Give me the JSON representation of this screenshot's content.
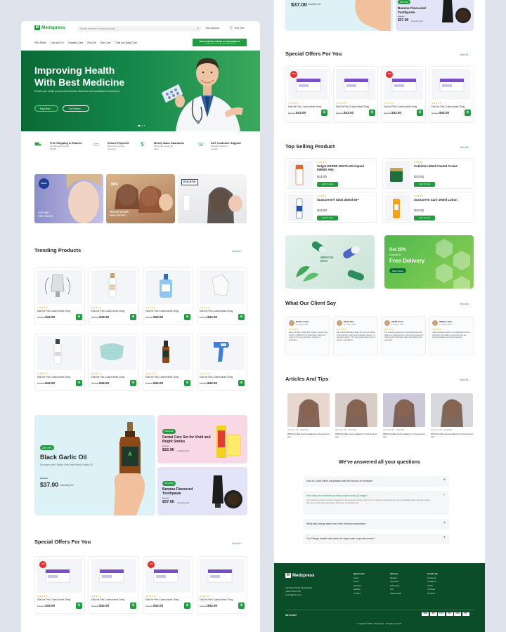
{
  "brand": {
    "name": "Medxpress"
  },
  "header": {
    "search_placeholder": "Search medicine, medical products",
    "account": "Your Account",
    "cart": "Your Cart",
    "categories": [
      "Pain Relief",
      "Cold and Flu",
      "Diabetes Care",
      "First Aid",
      "Skin Care",
      "Child and Baby Care"
    ],
    "promo_line1": "FREE SHIPPING ORDER BY DECEMBER 15",
    "promo_line2": "On all orders over $ 129 within this holiday season"
  },
  "hero": {
    "title_line1": "Improving Health",
    "title_line2": "With Best Medicine",
    "subtitle": "Elevate your health journey with exclusive discounts and unparalleled convenience.",
    "shop_btn": "Shop Now",
    "top_btn": "Top Product"
  },
  "features": [
    {
      "title": "Free Shipping & Returns",
      "desc": "For all orders over $ 199.00",
      "icon": "truck-icon"
    },
    {
      "title": "Secure Payment",
      "desc": "We ensure secure payment",
      "icon": "card-icon"
    },
    {
      "title": "Money Back Guarantee",
      "desc": "Returning money 30 days",
      "icon": "money-icon"
    },
    {
      "title": "24/7 Customer Support",
      "desc": "Friendly customer support",
      "icon": "support-icon"
    }
  ],
  "banners": {
    "nivea_logo": "NIVEA",
    "nivea_text1": "Anti-age",
    "nivea_text2": "Skin Serum",
    "wealth_pct": "50%",
    "wealth_text1": "Natural Wealth",
    "wealth_text2": "Beta karoten",
    "eucerin": "Eucerin"
  },
  "trending": {
    "title": "Trending Products",
    "view_all": "View All",
    "items": [
      {
        "name": "EllaOne Film-Coated tablet 30mg",
        "old": "$43.00",
        "price": "$43.00"
      },
      {
        "name": "EllaOne Film-Coated tablet 30mg",
        "old": "$43.00",
        "price": "$43.00"
      },
      {
        "name": "EllaOne Film-Coated tablet 30mg",
        "old": "$43.00",
        "price": "$43.00"
      },
      {
        "name": "EllaOne Film-Coated tablet 30mg",
        "old": "$43.00",
        "price": "$43.00"
      },
      {
        "name": "EllaOne Film-Coated tablet 30mg",
        "old": "$43.00",
        "price": "$43.00"
      },
      {
        "name": "EllaOne Film-Coated tablet 30mg",
        "old": "$43.00",
        "price": "$43.00"
      },
      {
        "name": "EllaOne Film-Coated tablet 30mg",
        "old": "$43.00",
        "price": "$43.00"
      },
      {
        "name": "EllaOne Film-Coated tablet 30mg",
        "old": "$43.00",
        "price": "$43.00"
      }
    ]
  },
  "promo": {
    "garlic": {
      "off": "25% OFF",
      "title": "Black Garlic Oil",
      "desc": "Stronger and Thicker Hair With Black Garlic Oil",
      "old": "$37.00",
      "price": "$37.00",
      "tax": "Including Tax"
    },
    "dental": {
      "off": "25% OFF",
      "title": "Dental Care Set for Vivid and Bright Smiles",
      "old": "$22.90",
      "price": "$22.90",
      "tax": "Including Tax"
    },
    "banana": {
      "off": "25% OFF",
      "title": "Banana Flavoured Toothpaste",
      "old": "$37.00",
      "price": "$37.00",
      "tax": "Including Tax"
    }
  },
  "special": {
    "title": "Special Offers For You",
    "view_all": "View All",
    "items": [
      {
        "name": "EllaOne Film-Coated tablet 30mg",
        "old": "$43.00",
        "price": "$43.00",
        "badge": "-15%"
      },
      {
        "name": "EllaOne Film-Coated tablet 30mg",
        "old": "$43.00",
        "price": "$43.00",
        "badge": ""
      },
      {
        "name": "EllaOne Film-Coated tablet 30mg",
        "old": "$43.00",
        "price": "$43.00",
        "badge": "-15%"
      },
      {
        "name": "EllaOne Film-Coated tablet 30mg",
        "old": "$43.00",
        "price": "$43.00",
        "badge": ""
      }
    ]
  },
  "right_top": {
    "price": "$37.00",
    "tax": "Including Tax",
    "off": "25% OFF",
    "title": "Banana Flavoured Toothpaste",
    "old": "$37.00",
    "price2": "$37.00",
    "tax2": "Including Tax"
  },
  "top_selling": {
    "title": "Top Selling Product",
    "view_all": "View All",
    "add": "Add To Cart",
    "items": [
      {
        "name": "Solgar ESTER 100 PLUS Kapsul 500MG A50",
        "price": "$43.00"
      },
      {
        "name": "Cetirizine 50ml Coated Creme",
        "price": "$43.00"
      },
      {
        "name": "Sunscreen® Stick 250ml 50+",
        "price": "$43.00"
      },
      {
        "name": "Sunscreen Care 200ml Lotion",
        "price": "$43.00"
      }
    ]
  },
  "info_banner": {
    "left_text": "MEDICAL INFO",
    "get": "Get 25%",
    "discount": "Discount &",
    "free": "Free Delivery",
    "btn": "Place Order"
  },
  "clients": {
    "title": "What Our Client Say",
    "view_all": "View All",
    "items": [
      {
        "name": "Daniel Lomer",
        "date": "12 August 2024",
        "text": "Every so often i suffer from cystitis. Going to the doctors is difficult if not impossible. Placed an order on F it to be refunded. It gotten of antibiotics."
      },
      {
        "name": "David Rue",
        "date": "12 August 2024",
        "text": "ad reviews Pharmacy Tower By sure to be Plus multi vitamins, credit grea chewable vitamins, or prescript vitamin. The store books helps sim pl y all your medications."
      },
      {
        "name": "Steffa Anna",
        "date": "12 August 2024",
        "text": "The customer service for local pharmacies will always be willing get the order was compared to other generic pharmacy when bombarded with questions."
      },
      {
        "name": "William Jack",
        "date": "12 August 2024",
        "text": "Great customer service. It's refreshing to find a pharmacy that makes you feel like you are anything assign are informed answer."
      }
    ]
  },
  "articles": {
    "title": "Articles And Tips",
    "view_all": "View All",
    "items": [
      {
        "meta": "December Tips - 12/02/2024",
        "title": "Which herbal mood enhancer is the best for you"
      },
      {
        "meta": "December Tips - 12/02/2024",
        "title": "Which herbal mood enhancer is the best for you"
      },
      {
        "meta": "December Tips - 12/02/2024",
        "title": "Which herbal mood enhancer is the best for you"
      },
      {
        "meta": "December Tips - 12/02/2024",
        "title": "Which herbal mood enhancer is the best for you"
      }
    ]
  },
  "faq": {
    "title": "We've answered all your questions",
    "items": [
      {
        "q": "How do I start online consultation with the doctors on medicae?",
        "open": false,
        "a": ""
      },
      {
        "q": "How does the customer success process work at Deluge?",
        "open": true,
        "a": "Our customer success process is designed to be seamless. Simply reach out to us with your requirements, and our dedicated team will work closely with you to understand your goals, objectives, and preferences."
      },
      {
        "q": "What sets Deluge apart from other Services companies?",
        "open": false,
        "a": ""
      },
      {
        "q": "Can Deluge handle bulk orders for large-scale corporate events?",
        "open": false,
        "a": ""
      }
    ]
  },
  "footer": {
    "address": "123 Road, Dhaka, Bangladesh",
    "phone": "+880 17031 6700",
    "email": "contact@mpk.com",
    "accept": "WE ACCEPT",
    "copyright": "Copyright © 2024 - Medxpress - All rights reserved.",
    "col1_title": "Quick Links",
    "col1": [
      "Home",
      "About",
      "Services",
      "Garden",
      "Contact"
    ],
    "col2_title": "Services",
    "col2": [
      "Medical",
      "Operation",
      "Laboratory",
      "ICU",
      "Patient Ward"
    ],
    "col3_title": "Social Link",
    "col3": [
      "Facebook",
      "Instagram",
      "Twitter",
      "YouTube",
      "Pinterest"
    ],
    "cards": [
      "VISA",
      "MC",
      "AMEX",
      "PAY",
      "VISA",
      "PAY"
    ]
  },
  "colors": {
    "primary": "#1f9d3f",
    "dark_green": "#0b4d28",
    "red": "#e52d2d",
    "star": "#f5a623"
  }
}
